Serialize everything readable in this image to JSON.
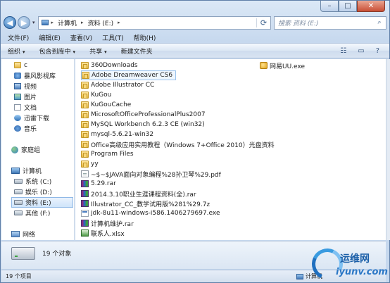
{
  "window": {
    "caption_minimize": "–",
    "caption_maximize": "□",
    "caption_close": "✕"
  },
  "address": {
    "back_icon": "◀",
    "forward_icon": "▶",
    "dropdown_icon": "▾",
    "crumbs": [
      "计算机",
      "资料 (E:)"
    ],
    "separator": "▸",
    "refresh_icon": "⟳"
  },
  "search": {
    "placeholder": "搜索 资料 (E:)",
    "icon": "⌕"
  },
  "menu": [
    "文件(F)",
    "编辑(E)",
    "查看(V)",
    "工具(T)",
    "帮助(H)"
  ],
  "toolbar": {
    "organize": "组织",
    "include_in_library": "包含到库中",
    "share": "共享",
    "new_folder": "新建文件夹",
    "arrow": "▾",
    "view_icon": "☷",
    "preview_icon": "▭",
    "help_icon": "?"
  },
  "nav_tree": [
    {
      "label": "c",
      "icon": "folder"
    },
    {
      "label": "暴风影视库",
      "icon": "storm"
    },
    {
      "label": "视频",
      "icon": "video"
    },
    {
      "label": "图片",
      "icon": "pic"
    },
    {
      "label": "文档",
      "icon": "doc"
    },
    {
      "label": "迅雷下载",
      "icon": "thunder"
    },
    {
      "label": "音乐",
      "icon": "music"
    },
    {
      "label": "家庭组",
      "icon": "group"
    },
    {
      "label": "计算机",
      "icon": "computer"
    },
    {
      "label": "系统 (C:)",
      "icon": "drive"
    },
    {
      "label": "娱乐 (D:)",
      "icon": "drive"
    },
    {
      "label": "资料 (E:)",
      "icon": "drive"
    },
    {
      "label": "其他 (F:)",
      "icon": "drive"
    },
    {
      "label": "网络",
      "icon": "net"
    }
  ],
  "files": [
    {
      "name": "360Downloads",
      "type": "folder"
    },
    {
      "name": "Adobe Dreamweaver CS6",
      "type": "folder"
    },
    {
      "name": "Adobe Illustrator CC",
      "type": "folder"
    },
    {
      "name": "KuGou",
      "type": "folder"
    },
    {
      "name": "KuGouCache",
      "type": "folder"
    },
    {
      "name": "MicrosoftOfficeProfessionalPlus2007",
      "type": "folder"
    },
    {
      "name": "MySQL Workbench 6.2.3 CE (win32)",
      "type": "folder"
    },
    {
      "name": "mysql-5.6.21-win32",
      "type": "folder"
    },
    {
      "name": "Office高级应用实用教程（Windows 7+Office 2010）光盘资料",
      "type": "folder"
    },
    {
      "name": "Program Files",
      "type": "folder"
    },
    {
      "name": "yy",
      "type": "folder"
    },
    {
      "name": "~$~$JAVA面向对象编程%28孙卫琴%29.pdf",
      "type": "pdf"
    },
    {
      "name": "5.29.rar",
      "type": "rar"
    },
    {
      "name": "2014.3.10职业生涯课程资料(全).rar",
      "type": "rar"
    },
    {
      "name": "Illustrator_CC_教学试用版%281%29.7z",
      "type": "7z"
    },
    {
      "name": "jdk-8u11-windows-i586.1406279697.exe",
      "type": "exe"
    },
    {
      "name": "计算机维护.rar",
      "type": "rar"
    },
    {
      "name": "联系人.xlsx",
      "type": "xlsx"
    },
    {
      "name": "网易UU.exe",
      "type": "ntes"
    }
  ],
  "details": {
    "count": "19 个对象"
  },
  "status": {
    "items": "19 个项目",
    "location": "计算机"
  },
  "watermark": {
    "cn": "运维网",
    "url": "iyunv.com"
  }
}
